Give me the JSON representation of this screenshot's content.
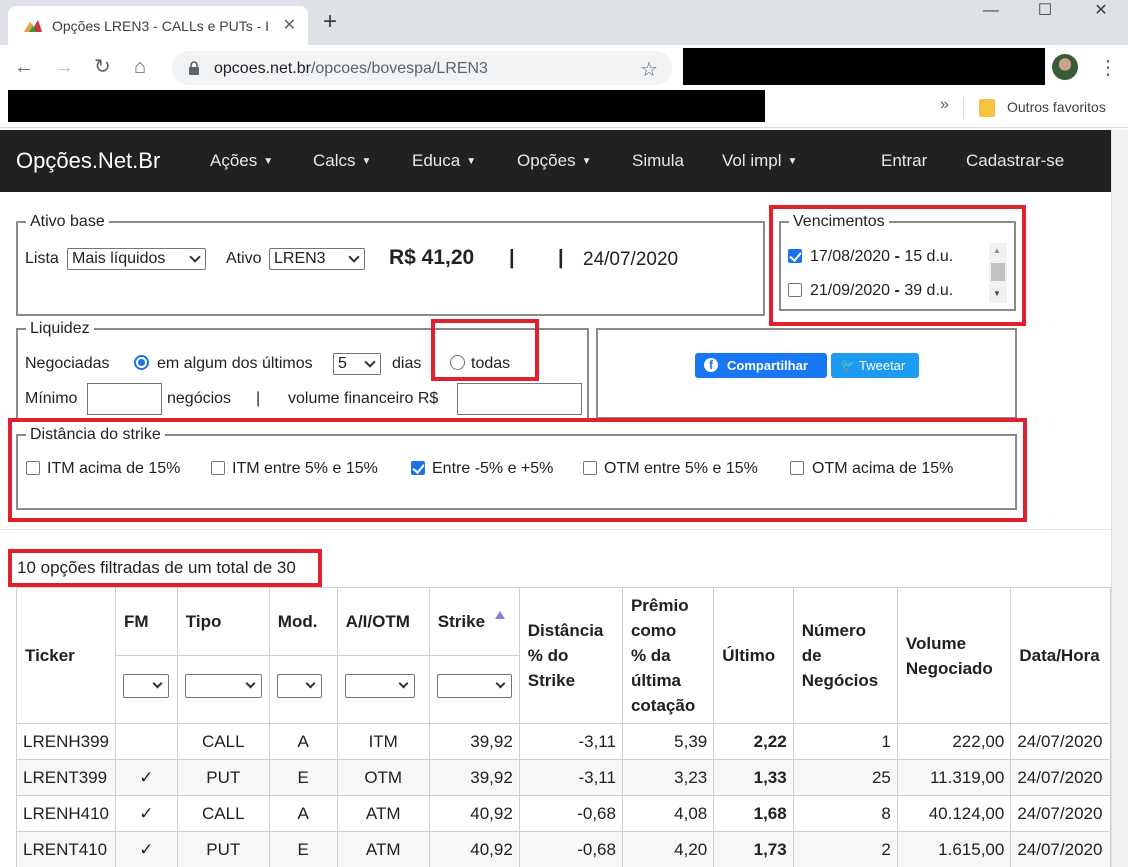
{
  "browser": {
    "tab_title": "Opções LREN3 - CALLs e PUTs - I",
    "url_host": "opcoes.net.br",
    "url_path": "/opcoes/bovespa/LREN3",
    "bookmark_folder": "Outros favoritos"
  },
  "nav": {
    "brand": "Opções.Net.Br",
    "items": [
      "Ações",
      "Calcs",
      "Educa",
      "Opções",
      "Simula",
      "Vol impl"
    ],
    "login": "Entrar",
    "signup": "Cadastrar-se"
  },
  "ativo_base": {
    "legend": "Ativo base",
    "lista_label": "Lista",
    "lista_value": "Mais líquidos",
    "ativo_label": "Ativo",
    "ativo_value": "LREN3",
    "price": "R$ 41,20",
    "sep1": "|",
    "sep2": "|",
    "date": "24/07/2020"
  },
  "vencimentos": {
    "legend": "Vencimentos",
    "items": [
      {
        "label": "17/08/2020",
        "du": "15 d.u.",
        "checked": true
      },
      {
        "label": "21/09/2020",
        "du": "39 d.u.",
        "checked": false
      }
    ],
    "dash": "-"
  },
  "liquidez": {
    "legend": "Liquidez",
    "negociadas_label": "Negociadas",
    "option1": "em algum dos últimos",
    "days_value": "5",
    "days_label": "dias",
    "option2": "todas",
    "minimo_label": "Mínimo",
    "negocios_label": "negócios",
    "sep": "|",
    "volume_label": "volume financeiro R$"
  },
  "share": {
    "facebook": "Compartilhar",
    "twitter": "Tweetar"
  },
  "strike": {
    "legend": "Distância do strike",
    "options": [
      {
        "label": "ITM acima de 15%",
        "checked": false
      },
      {
        "label": "ITM entre 5% e 15%",
        "checked": false
      },
      {
        "label": "Entre -5% e +5%",
        "checked": true
      },
      {
        "label": "OTM entre 5% e 15%",
        "checked": false
      },
      {
        "label": "OTM acima de 15%",
        "checked": false
      }
    ]
  },
  "count_text": "10 opções filtradas de um total de 30",
  "table": {
    "headers": {
      "ticker": "Ticker",
      "fm": "FM",
      "tipo": "Tipo",
      "mod": "Mod.",
      "aiotm": "A/I/OTM",
      "strike": "Strike",
      "dist_l1": "Distância",
      "dist_l2": "% do",
      "dist_l3": "Strike",
      "premio_l1": "Prêmio",
      "premio_l2": "como",
      "premio_l3": "% da",
      "premio_l4": "última",
      "premio_l5": "cotação",
      "ultimo": "Último",
      "num_l1": "Número",
      "num_l2": "de",
      "num_l3": "Negócios",
      "vol_l1": "Volume",
      "vol_l2": "Negociado",
      "datahora": "Data/Hora"
    },
    "rows": [
      {
        "ticker": "LRENH399",
        "fm": "",
        "tipo": "CALL",
        "mod": "A",
        "aiotm": "ITM",
        "strike": "39,92",
        "dist": "-3,11",
        "premio": "5,39",
        "ultimo": "2,22",
        "num": "1",
        "vol": "222,00",
        "data": "24/07/2020"
      },
      {
        "ticker": "LRENT399",
        "fm": "✓",
        "tipo": "PUT",
        "mod": "E",
        "aiotm": "OTM",
        "strike": "39,92",
        "dist": "-3,11",
        "premio": "3,23",
        "ultimo": "1,33",
        "num": "25",
        "vol": "11.319,00",
        "data": "24/07/2020"
      },
      {
        "ticker": "LRENH410",
        "fm": "✓",
        "tipo": "CALL",
        "mod": "A",
        "aiotm": "ATM",
        "strike": "40,92",
        "dist": "-0,68",
        "premio": "4,08",
        "ultimo": "1,68",
        "num": "8",
        "vol": "40.124,00",
        "data": "24/07/2020"
      },
      {
        "ticker": "LRENT410",
        "fm": "✓",
        "tipo": "PUT",
        "mod": "E",
        "aiotm": "ATM",
        "strike": "40,92",
        "dist": "-0,68",
        "premio": "4,20",
        "ultimo": "1,73",
        "num": "2",
        "vol": "1.615,00",
        "data": "24/07/2020"
      }
    ]
  }
}
